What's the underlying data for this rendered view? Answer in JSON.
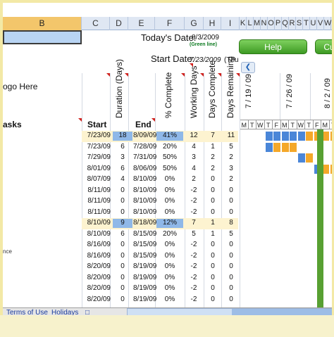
{
  "columns": {
    "b": "B",
    "c": "C",
    "d": "D",
    "e": "E",
    "f": "F",
    "g": "G",
    "h": "H",
    "i": "I",
    "gantt": [
      "K",
      "L",
      "M",
      "N",
      "O",
      "P",
      "Q",
      "R",
      "S",
      "T",
      "U",
      "V",
      "W",
      "X"
    ]
  },
  "header": {
    "todays_date_label": "Today's Date:",
    "todays_date_value": "8/3/2009",
    "green_line": "(Green line)",
    "start_date_label": "Start Date:",
    "start_date_value": "7/23/2009",
    "start_day": "(Thu",
    "logo_text": "ogo Here",
    "help_button": "Help",
    "cu_button": "Cu"
  },
  "table_headers": {
    "tasks": "asks",
    "start": "Start",
    "duration": "Duration (Days)",
    "end": "End",
    "pct": "% Complete",
    "working_days": "Working Days",
    "days_complete": "Days Complete",
    "days_remaining": "Days Remaining"
  },
  "week_dates": [
    "7 / 19 / 09",
    "7 / 26 / 09",
    "8 / 2 / 09"
  ],
  "day_letters": [
    "M",
    "T",
    "W",
    "T",
    "F",
    "M",
    "T",
    "W",
    "T",
    "F",
    "M",
    "T",
    "W",
    "T",
    "F"
  ],
  "rows": [
    {
      "start": "7/23/09",
      "dur": "18",
      "end": "8/09/09",
      "pct": "41%",
      "wd": "12",
      "dc": "7",
      "dr": "11",
      "hl": true
    },
    {
      "start": "7/23/09",
      "dur": "6",
      "end": "7/28/09",
      "pct": "20%",
      "wd": "4",
      "dc": "1",
      "dr": "5",
      "hl": false
    },
    {
      "start": "7/29/09",
      "dur": "3",
      "end": "7/31/09",
      "pct": "50%",
      "wd": "3",
      "dc": "2",
      "dr": "2",
      "hl": false
    },
    {
      "start": "8/01/09",
      "dur": "6",
      "end": "8/06/09",
      "pct": "50%",
      "wd": "4",
      "dc": "2",
      "dr": "3",
      "hl": false
    },
    {
      "start": "8/07/09",
      "dur": "4",
      "end": "8/10/09",
      "pct": "0%",
      "wd": "2",
      "dc": "0",
      "dr": "2",
      "hl": false
    },
    {
      "start": "8/11/09",
      "dur": "0",
      "end": "8/10/09",
      "pct": "0%",
      "wd": "-2",
      "dc": "0",
      "dr": "0",
      "hl": false
    },
    {
      "start": "8/11/09",
      "dur": "0",
      "end": "8/10/09",
      "pct": "0%",
      "wd": "-2",
      "dc": "0",
      "dr": "0",
      "hl": false
    },
    {
      "start": "8/11/09",
      "dur": "0",
      "end": "8/10/09",
      "pct": "0%",
      "wd": "-2",
      "dc": "0",
      "dr": "0",
      "hl": false
    },
    {
      "start": "8/10/09",
      "dur": "9",
      "end": "8/18/09",
      "pct": "12%",
      "wd": "7",
      "dc": "1",
      "dr": "8",
      "hl": true
    },
    {
      "start": "8/10/09",
      "dur": "6",
      "end": "8/15/09",
      "pct": "20%",
      "wd": "5",
      "dc": "1",
      "dr": "5",
      "hl": false
    },
    {
      "start": "8/16/09",
      "dur": "0",
      "end": "8/15/09",
      "pct": "0%",
      "wd": "-2",
      "dc": "0",
      "dr": "0",
      "hl": false
    },
    {
      "start": "8/16/09",
      "dur": "0",
      "end": "8/15/09",
      "pct": "0%",
      "wd": "-2",
      "dc": "0",
      "dr": "0",
      "hl": false
    },
    {
      "start": "8/20/09",
      "dur": "0",
      "end": "8/19/09",
      "pct": "0%",
      "wd": "-2",
      "dc": "0",
      "dr": "0",
      "hl": false
    },
    {
      "start": "8/20/09",
      "dur": "0",
      "end": "8/19/09",
      "pct": "0%",
      "wd": "-2",
      "dc": "0",
      "dr": "0",
      "hl": false
    },
    {
      "start": "8/20/09",
      "dur": "0",
      "end": "8/19/09",
      "pct": "0%",
      "wd": "-2",
      "dc": "0",
      "dr": "0",
      "hl": false
    },
    {
      "start": "8/20/09",
      "dur": "0",
      "end": "8/19/09",
      "pct": "0%",
      "wd": "-2",
      "dc": "0",
      "dr": "0",
      "hl": false
    }
  ],
  "side_label": "nce",
  "tabs": [
    "Terms of Use",
    "Holidays"
  ],
  "colors": {
    "accent_green": "#58a032",
    "bar_blue": "#4a86d8",
    "bar_orange": "#f4a82a",
    "highlight": "#fdf3d0"
  }
}
